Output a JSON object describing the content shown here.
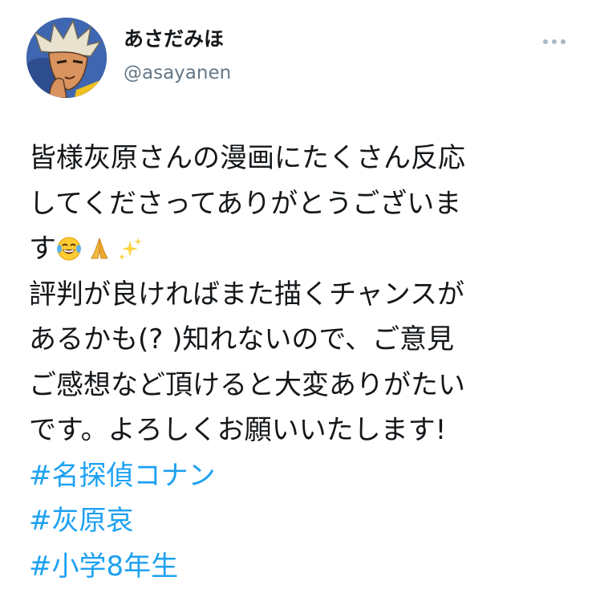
{
  "author": {
    "display_name": "あさだみほ",
    "handle": "@asayanen"
  },
  "tweet": {
    "lines": [
      "皆様灰原さんの漫画にたくさん反応",
      "してくださってありがとうございま",
      "す",
      "評判が良ければまた描くチャンスが",
      "あるかも(? )知れないので、ご意見",
      "ご感想など頂けると大変ありがたい",
      "です。よろしくお願いいたします!"
    ],
    "emojis": [
      "face-with-tears-of-joy",
      "folded-hands",
      "sparkles"
    ],
    "hashtags": [
      "#名探偵コナン",
      "#灰原哀",
      "#小学8年生"
    ]
  },
  "colors": {
    "text": "#14171a",
    "secondary": "#657786",
    "link": "#1da1f2"
  }
}
